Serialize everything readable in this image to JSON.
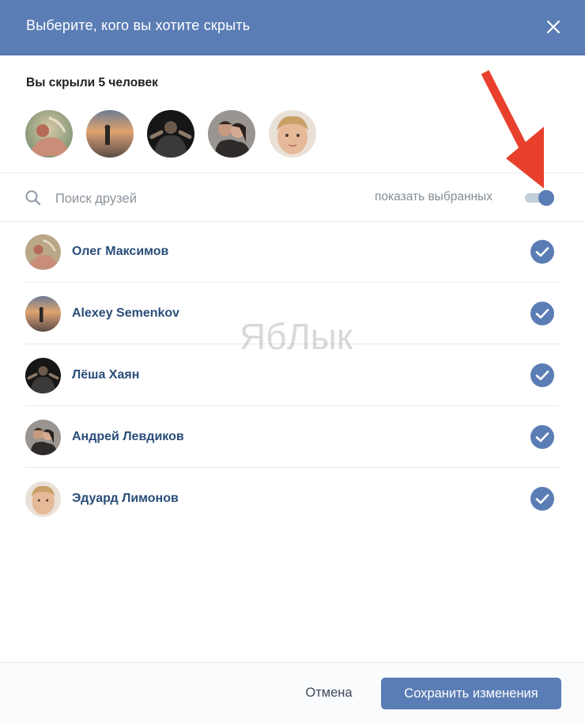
{
  "header": {
    "title": "Выберите, кого вы хотите скрыть",
    "close_icon": "close-icon"
  },
  "hidden": {
    "title": "Вы скрыли 5 человек"
  },
  "search": {
    "placeholder": "Поиск друзей",
    "value": "",
    "icon": "search-icon"
  },
  "filter": {
    "label": "показать выбранных",
    "enabled": true
  },
  "friends": [
    {
      "name": "Олег Максимов",
      "selected": true
    },
    {
      "name": "Alexey Semenkov",
      "selected": true
    },
    {
      "name": "Лёша Хаян",
      "selected": true
    },
    {
      "name": "Андрей Левдиков",
      "selected": true
    },
    {
      "name": "Эдуард Лимонов",
      "selected": true
    }
  ],
  "watermark": "ЯбЛык",
  "footer": {
    "cancel_label": "Отмена",
    "save_label": "Сохранить изменения"
  },
  "colors": {
    "header": "#5b7db5",
    "accent": "#5b7db5",
    "name_link": "#2a4d79",
    "arrow": "#e8402c"
  }
}
